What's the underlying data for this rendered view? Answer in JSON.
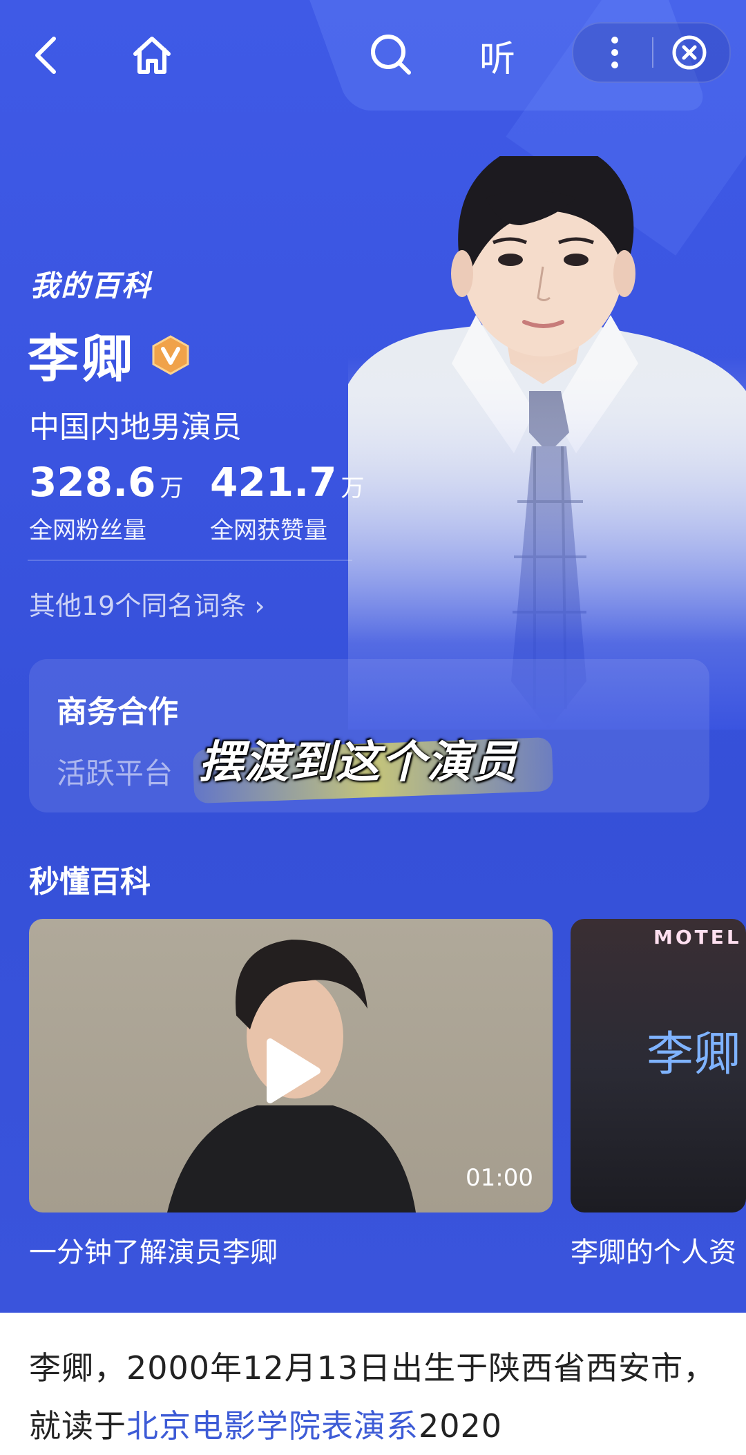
{
  "topbar": {
    "listen_label": "听"
  },
  "profile": {
    "section_label": "我的百科",
    "name": "李卿",
    "occupation": "中国内地男演员",
    "stats": [
      {
        "value": "328.6",
        "unit": "万",
        "label": "全网粉丝量"
      },
      {
        "value": "421.7",
        "unit": "万",
        "label": "全网获赞量"
      }
    ],
    "other_entries": "其他19个同名词条 ›"
  },
  "business": {
    "title": "商务合作",
    "subtitle": "活跃平台"
  },
  "overlay_caption": "摆渡到这个演员",
  "quick_wiki": {
    "title": "秒懂百科",
    "videos": [
      {
        "title": "一分钟了解演员李卿",
        "duration": "01:00"
      },
      {
        "title": "李卿的个人资",
        "overlay_text": "李卿",
        "neon_text": "MOTEL"
      }
    ]
  },
  "intro": {
    "text_before": "李卿，2000年12月13日出生于陕西省西安市，就读于",
    "link_text": "北京电影学院表演系",
    "text_after": "2020"
  },
  "colors": {
    "hero_bg": "#3a54e0",
    "link": "#3d5bd6",
    "badge": "#f0a24a"
  }
}
